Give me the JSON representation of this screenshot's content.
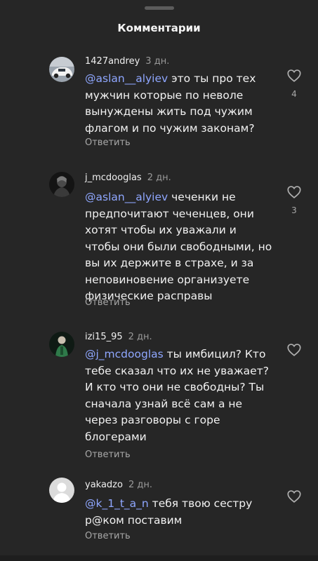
{
  "header": {
    "title": "Комментарии"
  },
  "comments": [
    {
      "username": "1427andrey",
      "time": "3 дн.",
      "mention": "@aslan__alyiev",
      "text": " это ты про тех мужчин которые по неволе вынуждены жить под чужим флагом и по чужим законам?",
      "reply_label": "Ответить",
      "likes": "4",
      "avatar_icon": "car-avatar"
    },
    {
      "username": "j_mcdooglas",
      "time": "2 дн.",
      "mention": "@aslan__alyiev",
      "text": " чеченки не предпочитают чеченцев, они хотят чтобы их уважали и чтобы они были свободными, но вы их держите в страхе, и за неповиновение организуете физические расправы",
      "reply_label": "Ответить",
      "likes": "3",
      "avatar_icon": "dark-figure-avatar"
    },
    {
      "username": "izi15_95",
      "time": "2 дн.",
      "mention": "@j_mcdooglas",
      "text": " ты имбицил? Кто тебе сказал что их не уважает? И кто что они не свободны? Ты сначала узнай всё сам а не через разговоры с горе блогерами",
      "reply_label": "Ответить",
      "likes": "",
      "avatar_icon": "green-figure-avatar"
    },
    {
      "username": "yakadzo",
      "time": "2 дн.",
      "mention": "@k_1_t_a_n",
      "text": " тебя твою сестру р@ком поставим",
      "reply_label": "Ответить",
      "likes": "",
      "avatar_icon": "default-avatar"
    }
  ],
  "colors": {
    "background": "#262626",
    "mention": "#8fa7ff",
    "secondary_text": "#a8a8a8"
  }
}
